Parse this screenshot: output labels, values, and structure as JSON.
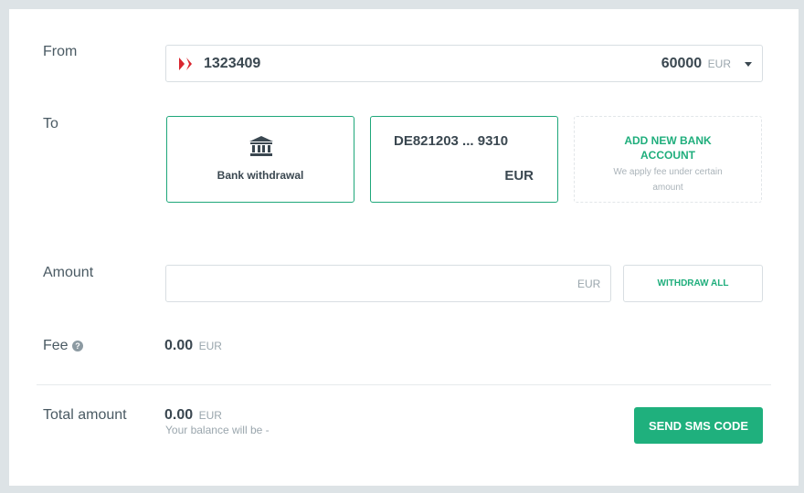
{
  "form": {
    "from_label": "From",
    "to_label": "To",
    "amount_label": "Amount",
    "fee_label": "Fee",
    "total_label": "Total amount"
  },
  "source_account": {
    "number": "1323409",
    "balance": "60000",
    "currency": "EUR"
  },
  "destinations": {
    "bank_withdrawal": {
      "label": "Bank withdrawal",
      "icon": "bank-icon"
    },
    "saved_account": {
      "iban": "DE821203 ... 9310",
      "currency": "EUR"
    },
    "add_new": {
      "title_line1": "ADD NEW BANK",
      "title_line2": "ACCOUNT",
      "sub_line1": "We apply fee under certain",
      "sub_line2": "amount"
    }
  },
  "amount": {
    "value": "",
    "currency": "EUR",
    "withdraw_all_label": "WITHDRAW ALL"
  },
  "fee": {
    "value": "0.00",
    "currency": "EUR",
    "help_glyph": "?"
  },
  "total": {
    "value": "0.00",
    "currency": "EUR",
    "balance_note": "Your balance will be -"
  },
  "actions": {
    "send_sms_label": "SEND SMS CODE"
  },
  "colors": {
    "accent": "#1fb07d",
    "selected_border": "#1ea77a",
    "text": "#3a4750"
  }
}
